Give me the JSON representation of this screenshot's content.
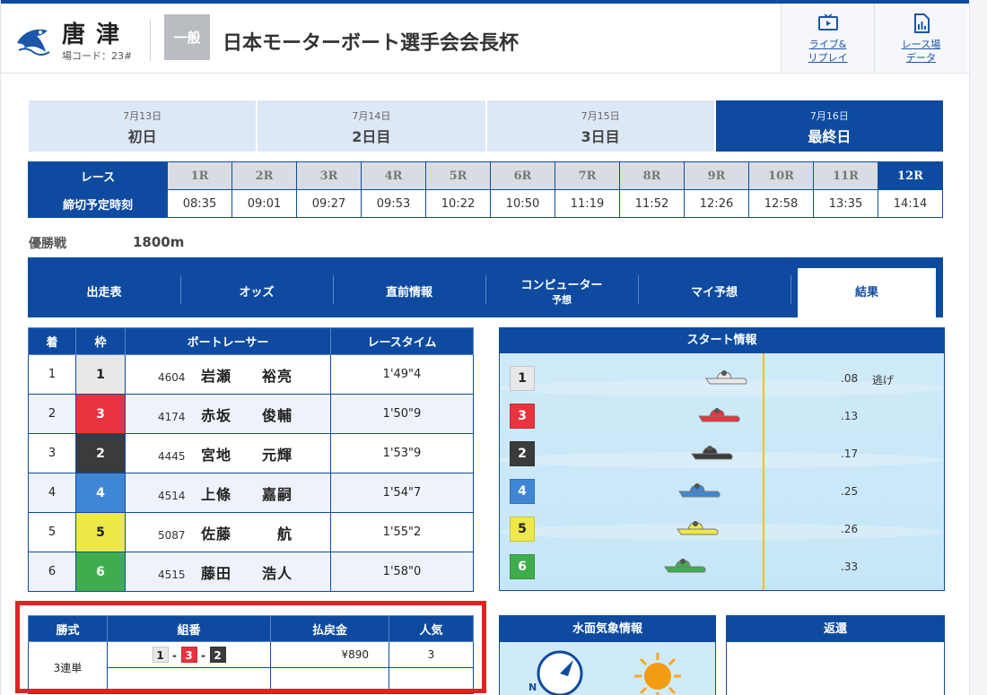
{
  "header": {
    "venue_name": "唐津",
    "venue_code": "場コード：23#",
    "grade": "一般",
    "race_title": "日本モーターボート選手会会長杯",
    "buttons": [
      {
        "label": "ライブ&\nリプレイ",
        "icon": "tv-play-icon"
      },
      {
        "label": "レース場\nデータ",
        "icon": "chart-document-icon"
      }
    ]
  },
  "days": [
    {
      "date": "7月13日",
      "name": "初日"
    },
    {
      "date": "7月14日",
      "name": "2日目"
    },
    {
      "date": "7月15日",
      "name": "3日目"
    },
    {
      "date": "7月16日",
      "name": "最終日"
    }
  ],
  "race_table": {
    "race_header": "レース",
    "time_header": "締切予定時刻",
    "races": [
      "1R",
      "2R",
      "3R",
      "4R",
      "5R",
      "6R",
      "7R",
      "8R",
      "9R",
      "10R",
      "11R",
      "12R"
    ],
    "times": [
      "08:35",
      "09:01",
      "09:27",
      "09:53",
      "10:22",
      "10:50",
      "11:19",
      "11:52",
      "12:26",
      "12:58",
      "13:35",
      "14:14"
    ]
  },
  "race_info": {
    "type": "優勝戦",
    "distance": "1800m"
  },
  "nav": {
    "tabs": [
      {
        "label": "出走表"
      },
      {
        "label": "オッズ"
      },
      {
        "label": "直前情報"
      },
      {
        "label": "コンピューター",
        "sub": "予想"
      },
      {
        "label": "マイ予想"
      },
      {
        "label": "結果"
      }
    ]
  },
  "results": {
    "headers": [
      "着",
      "枠",
      "ボートレーサー",
      "レースタイム"
    ],
    "rows": [
      {
        "place": "1",
        "frame": "1",
        "reg": "4604",
        "name": "岩瀬　　裕亮",
        "time": "1'49\"4"
      },
      {
        "place": "2",
        "frame": "3",
        "reg": "4174",
        "name": "赤坂　　俊輔",
        "time": "1'50\"9"
      },
      {
        "place": "3",
        "frame": "2",
        "reg": "4445",
        "name": "宮地　　元輝",
        "time": "1'53\"9"
      },
      {
        "place": "4",
        "frame": "4",
        "reg": "4514",
        "name": "上條　　嘉嗣",
        "time": "1'54\"7"
      },
      {
        "place": "5",
        "frame": "5",
        "reg": "5087",
        "name": "佐藤　　　航",
        "time": "1'55\"2"
      },
      {
        "place": "6",
        "frame": "6",
        "reg": "4515",
        "name": "藤田　　浩人",
        "time": "1'58\"0"
      }
    ]
  },
  "start_info": {
    "title": "スタート情報",
    "rows": [
      {
        "frame": "1",
        "st": ".08",
        "note": "逃げ",
        "boat_color": "#e8e8e8"
      },
      {
        "frame": "3",
        "st": ".13",
        "note": "",
        "boat_color": "#e8343f"
      },
      {
        "frame": "2",
        "st": ".17",
        "note": "",
        "boat_color": "#3b3b3b"
      },
      {
        "frame": "4",
        "st": ".25",
        "note": "",
        "boat_color": "#3f86d4"
      },
      {
        "frame": "5",
        "st": ".26",
        "note": "",
        "boat_color": "#eee84a"
      },
      {
        "frame": "6",
        "st": ".33",
        "note": "",
        "boat_color": "#3fad4e"
      }
    ]
  },
  "payout": {
    "headers": [
      "勝式",
      "組番",
      "払戻金",
      "人気"
    ],
    "bet_type": "3連単",
    "combo": [
      "1",
      "3",
      "2"
    ],
    "amount": "¥890",
    "popularity": "3"
  },
  "weather": {
    "title": "水面気象情報",
    "wind_label": "N"
  },
  "refund": {
    "title": "返還"
  },
  "colors": {
    "primary": "#0e4ba0",
    "highlight": "#e02323"
  }
}
